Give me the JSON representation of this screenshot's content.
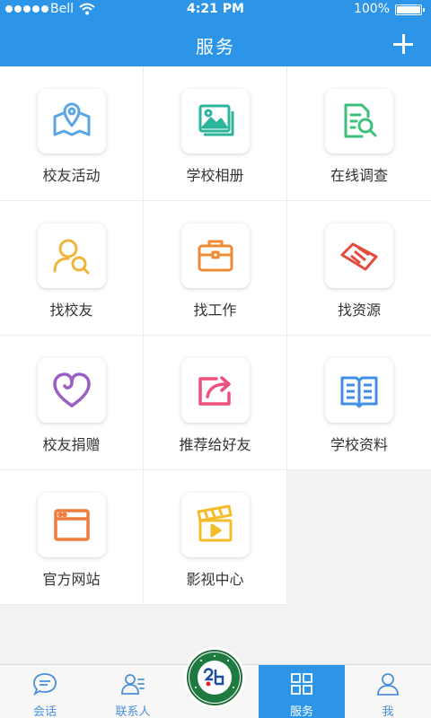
{
  "status": {
    "carrier": "Bell",
    "time": "4:21 PM",
    "battery": "100%"
  },
  "header": {
    "title": "服务"
  },
  "services": [
    {
      "label": "校友活动",
      "icon": "map-pin-icon",
      "color": "#5aa5e8"
    },
    {
      "label": "学校相册",
      "icon": "photo-album-icon",
      "color": "#2bb59a"
    },
    {
      "label": "在线调查",
      "icon": "document-search-icon",
      "color": "#3cc07a"
    },
    {
      "label": "找校友",
      "icon": "person-search-icon",
      "color": "#f0b43a"
    },
    {
      "label": "找工作",
      "icon": "briefcase-icon",
      "color": "#ee8a33"
    },
    {
      "label": "找资源",
      "icon": "handshake-icon",
      "color": "#e24b3d"
    },
    {
      "label": "校友捐赠",
      "icon": "heart-icon",
      "color": "#9a5fc4"
    },
    {
      "label": "推荐给好友",
      "icon": "share-icon",
      "color": "#ef4f7d"
    },
    {
      "label": "学校资料",
      "icon": "book-icon",
      "color": "#3f8ee8"
    },
    {
      "label": "官方网站",
      "icon": "browser-icon",
      "color": "#f07c3a"
    },
    {
      "label": "影视中心",
      "icon": "clapperboard-icon",
      "color": "#f3bd2a"
    }
  ],
  "tabs": [
    {
      "label": "会话",
      "icon": "chat-icon"
    },
    {
      "label": "联系人",
      "icon": "contacts-icon"
    },
    {
      "label": "服务",
      "icon": "grid-icon"
    },
    {
      "label": "我",
      "icon": "user-icon"
    }
  ],
  "colors": {
    "primary": "#2d95e8",
    "accent": "#4a90d9"
  }
}
